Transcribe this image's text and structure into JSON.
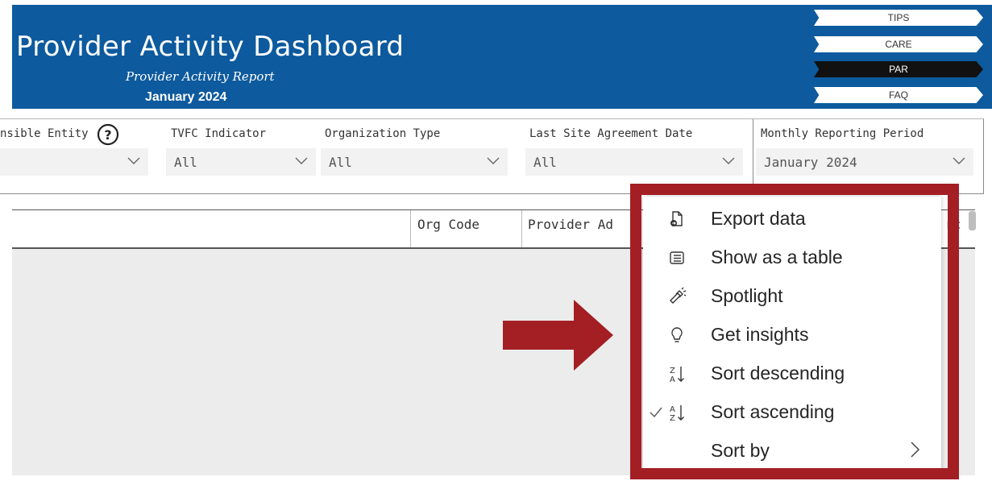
{
  "header": {
    "title": "Provider Activity Dashboard",
    "subtitle": "Provider Activity Report",
    "period": "January 2024",
    "nav_buttons": [
      {
        "label": "TIPS",
        "style": "light"
      },
      {
        "label": "CARE",
        "style": "light"
      },
      {
        "label": "PAR",
        "style": "dark"
      },
      {
        "label": "FAQ",
        "style": "light"
      }
    ]
  },
  "filters": [
    {
      "label": "nsible Entity",
      "value": ""
    },
    {
      "label": "TVFC Indicator",
      "value": "All"
    },
    {
      "label": "Organization Type",
      "value": "All"
    },
    {
      "label": "Last Site Agreement Date",
      "value": "All"
    },
    {
      "label": "Monthly Reporting Period",
      "value": "January 2024"
    }
  ],
  "table": {
    "columns": [
      "Org Code",
      "Provider Ad",
      "rc"
    ]
  },
  "context_menu": {
    "items": [
      {
        "label": "Export data",
        "icon": "export-icon"
      },
      {
        "label": "Show as a table",
        "icon": "table-icon"
      },
      {
        "label": "Spotlight",
        "icon": "spotlight-icon"
      },
      {
        "label": "Get insights",
        "icon": "lightbulb-icon"
      },
      {
        "label": "Sort descending",
        "icon": "sort-descending-icon"
      },
      {
        "label": "Sort ascending",
        "icon": "sort-ascending-icon",
        "checked": true
      },
      {
        "label": "Sort by",
        "icon": "",
        "submenu": true
      }
    ]
  },
  "colors": {
    "header_blue": "#0d5a9e",
    "highlight_red": "#a31f24"
  }
}
